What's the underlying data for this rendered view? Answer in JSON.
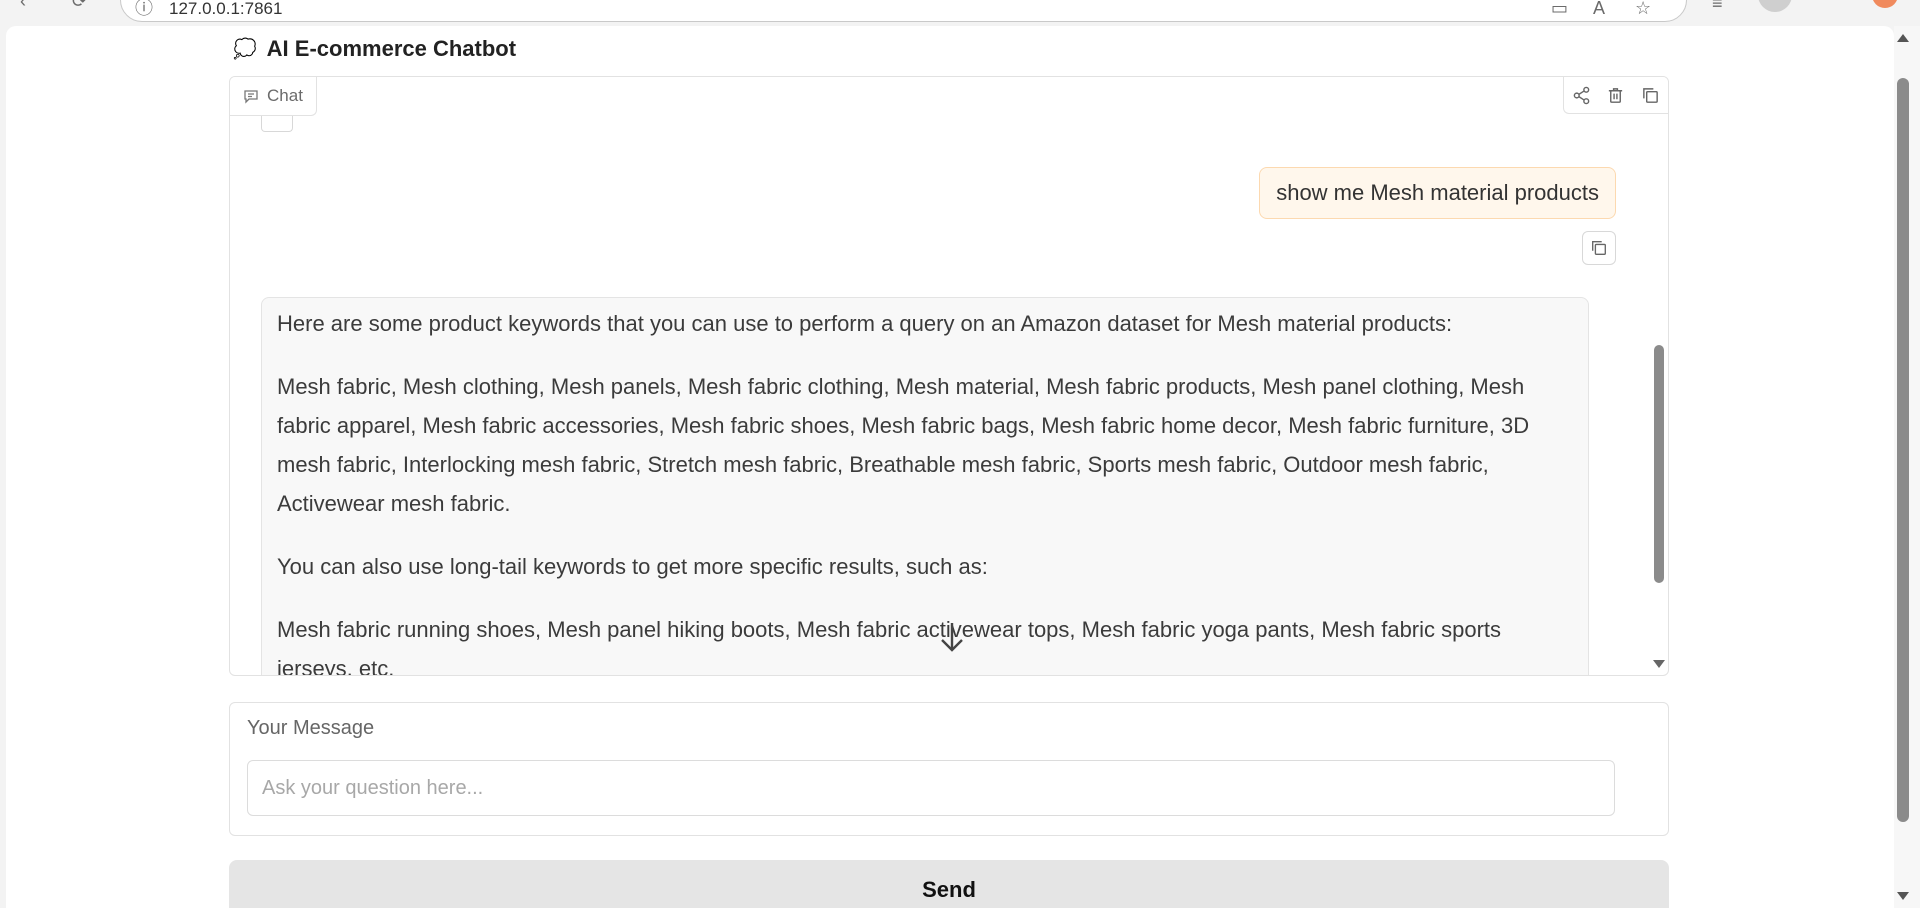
{
  "browser": {
    "url": "127.0.0.1:7861"
  },
  "header": {
    "emoji": "💭",
    "title": "AI E-commerce Chatbot"
  },
  "chat": {
    "label": "Chat",
    "icons": [
      "share-icon",
      "trash-icon",
      "copy-icon"
    ],
    "user_message": "show me Mesh material products",
    "bot_paragraphs": [
      "Here are some product keywords that you can use to perform a query on an Amazon dataset for Mesh material products:",
      "Mesh fabric, Mesh clothing, Mesh panels, Mesh fabric clothing, Mesh material, Mesh fabric products, Mesh panel clothing, Mesh fabric apparel, Mesh fabric accessories, Mesh fabric shoes, Mesh fabric bags, Mesh fabric home decor, Mesh fabric furniture, 3D mesh fabric, Interlocking mesh fabric, Stretch mesh fabric, Breathable mesh fabric, Sports mesh fabric, Outdoor mesh fabric, Activewear mesh fabric.",
      "You can also use long-tail keywords to get more specific results, such as:",
      "Mesh fabric running shoes, Mesh panel hiking boots, Mesh fabric activewear tops, Mesh fabric yoga pants, Mesh fabric sports jerseys, etc."
    ]
  },
  "input": {
    "label": "Your Message",
    "value": "",
    "placeholder": "Ask your question here..."
  },
  "actions": {
    "send_label": "Send"
  }
}
